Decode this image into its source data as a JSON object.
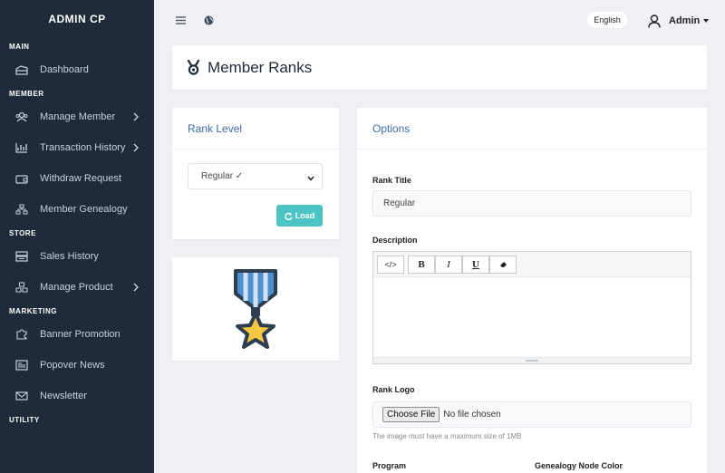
{
  "sidebar": {
    "brand": "ADMIN CP",
    "sections": {
      "main": "MAIN",
      "member": "MEMBER",
      "store": "STORE",
      "marketing": "MARKETING",
      "utility": "UTILITY"
    },
    "items": {
      "dashboard": "Dashboard",
      "manage_member": "Manage Member",
      "transaction_history": "Transaction History",
      "withdraw_request": "Withdraw Request",
      "member_genealogy": "Member Genealogy",
      "sales_history": "Sales History",
      "manage_product": "Manage Product",
      "banner_promotion": "Banner Promotion",
      "popover_news": "Popover News",
      "newsletter": "Newsletter"
    }
  },
  "topbar": {
    "language": "English",
    "user_name": "Admin",
    "icons": [
      "menu-icon",
      "globe-icon",
      "user-icon"
    ]
  },
  "page": {
    "title": "Member Ranks",
    "title_icon": "medal-icon"
  },
  "rank_level": {
    "title": "Rank Level",
    "selected": "Regular ✓",
    "load_label": "Load"
  },
  "options": {
    "title": "Options",
    "rank_title_label": "Rank Title",
    "rank_title_value": "Regular",
    "description_label": "Description",
    "toolbar": {
      "code": "</>",
      "bold": "B",
      "italic": "I",
      "underline": "U"
    },
    "rank_logo_label": "Rank Logo",
    "choose_file": "Choose File",
    "no_file": "No file chosen",
    "logo_hint": "The image must have a maximum size of 1MB",
    "program_label": "Program",
    "node_color_label": "Genealogy Node Color"
  },
  "colors": {
    "sidebar_bg": "#1f2b3a",
    "accent_blue": "#3d6aa8",
    "load_button": "#4cc4c3",
    "medal_blue": "#4f8fd0",
    "medal_star": "#f6c542",
    "medal_outline": "#2c3e50"
  }
}
